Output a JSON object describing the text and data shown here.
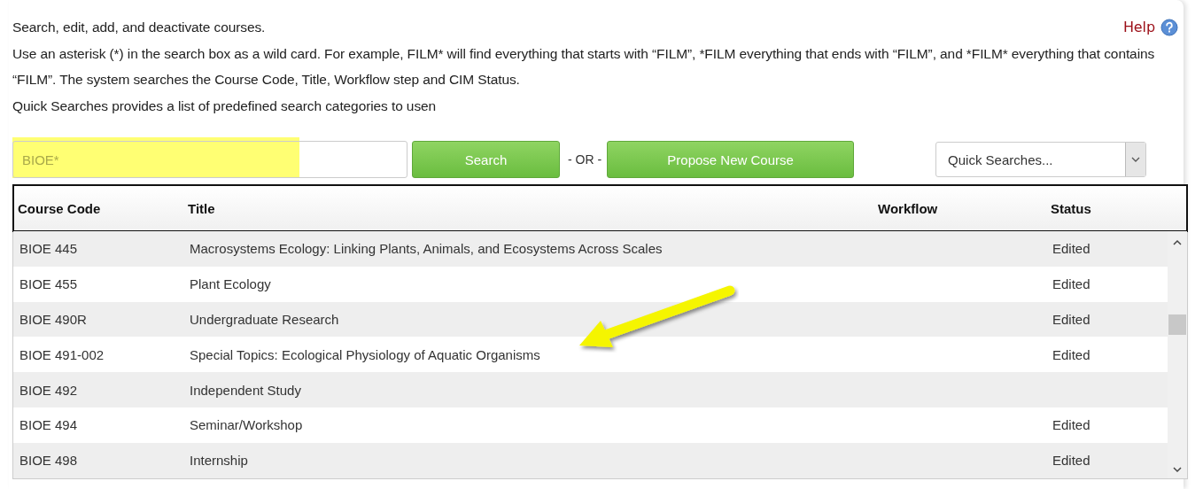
{
  "help": {
    "label": "Help"
  },
  "intro": [
    "Search, edit, add, and deactivate courses.",
    "Use an asterisk (*) in the search box as a wild card. For example, FILM* will find everything that starts with “FILM”, *FILM everything that ends with “FILM”, and *FILM* everything that contains “FILM”. The system searches the Course Code, Title, Workflow step and CIM Status.",
    "Quick Searches provides a list of predefined search categories to usen"
  ],
  "search": {
    "value": "BIOE*",
    "button": "Search",
    "separator": "- OR -",
    "propose_button": "Propose New Course",
    "quick_searches": "Quick Searches..."
  },
  "table": {
    "columns": [
      "Course Code",
      "Title",
      "Workflow",
      "Status"
    ],
    "rows": [
      {
        "code": "BIOE 445",
        "title": "Macrosystems Ecology: Linking Plants, Animals, and Ecosystems Across Scales",
        "status": "Edited"
      },
      {
        "code": "BIOE 455",
        "title": "Plant Ecology",
        "status": "Edited"
      },
      {
        "code": "BIOE 490R",
        "title": "Undergraduate Research",
        "status": "Edited"
      },
      {
        "code": "BIOE 491-002",
        "title": "Special Topics: Ecological Physiology of Aquatic Organisms",
        "status": "Edited"
      },
      {
        "code": "BIOE 492",
        "title": "Independent Study"
      },
      {
        "code": "BIOE 494",
        "title": "Seminar/Workshop",
        "status": "Edited"
      },
      {
        "code": "BIOE 498",
        "title": "Internship",
        "status": "Edited"
      }
    ]
  }
}
